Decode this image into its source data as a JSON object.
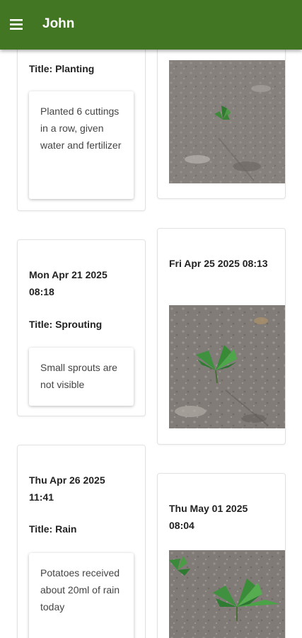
{
  "app_bar": {
    "title": "John",
    "menu_icon": "menu-icon"
  },
  "left_column": [
    {
      "title": "Title: Planting",
      "note": "Planted 6 cuttings in a row, given water and fertilizer"
    },
    {
      "date": "Mon Apr 21 2025 08:18",
      "title": "Title: Sprouting",
      "note": "Small sprouts are not visible"
    },
    {
      "date": "Thu Apr 26 2025 11:41",
      "title": "Title: Rain",
      "note": "Potatoes received about 20ml of rain today"
    }
  ],
  "right_column": [
    {
      "photo": "soil-with-small-sprout-photo"
    },
    {
      "date": "Fri Apr 25 2025 08:13",
      "photo": "soil-with-leafy-sprout-photo"
    },
    {
      "date": "Thu May 01 2025 08:04",
      "photo": "soil-with-young-plants-photo"
    }
  ],
  "colors": {
    "app_bar": "#437623",
    "card_border": "#e2e2e2",
    "text": "#222222"
  }
}
